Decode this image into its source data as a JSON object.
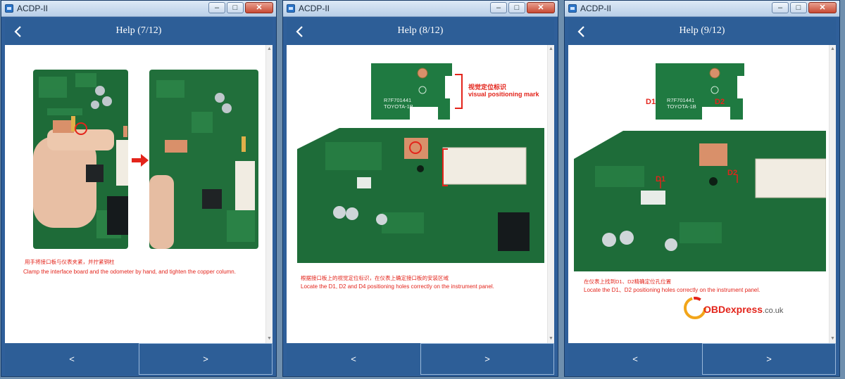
{
  "windows": [
    {
      "app_title": "ACDP-II",
      "header_title": "Help (7/12)",
      "caption_cn": "用手将接口板与仪表夹紧，并拧紧铜柱",
      "caption_en": "Clamp the interface board and the odometer by hand, and tighten the copper column.",
      "prev_label": "<",
      "next_label": ">"
    },
    {
      "app_title": "ACDP-II",
      "header_title": "Help (8/12)",
      "caption_cn": "根据接口板上的视觉定位标识，在仪表上确定接口板的安装区域",
      "caption_en": "Locate the D1, D2 and D4 positioning holes correctly on the instrument panel.",
      "annot_cn": "视觉定位标识",
      "annot_en": "visual positioning mark",
      "board_text_1": "R7F701441",
      "board_text_2": "TOYOTA-1B",
      "prev_label": "<",
      "next_label": ">"
    },
    {
      "app_title": "ACDP-II",
      "header_title": "Help (9/12)",
      "caption_cn": "在仪表上找到D1、D2精确定位孔位置",
      "caption_en": "Locate the D1、D2 positioning holes correctly on the instrument panel.",
      "board_text_1": "R7F701441",
      "board_text_2": "TOYOTA-1B",
      "label_d1": "D1",
      "label_d2": "D2",
      "watermark_brand": "OBDexpress",
      "watermark_tld": ".co.uk",
      "prev_label": "<",
      "next_label": ">"
    }
  ],
  "colors": {
    "header": "#2d5e97",
    "caption": "#e3241b",
    "pcb_green": "#1f6e3a",
    "copper": "#d9906a"
  },
  "icons": {
    "back": "back-chevron-icon",
    "minimize": "minimize-icon",
    "maximize": "maximize-icon",
    "close": "close-icon"
  }
}
